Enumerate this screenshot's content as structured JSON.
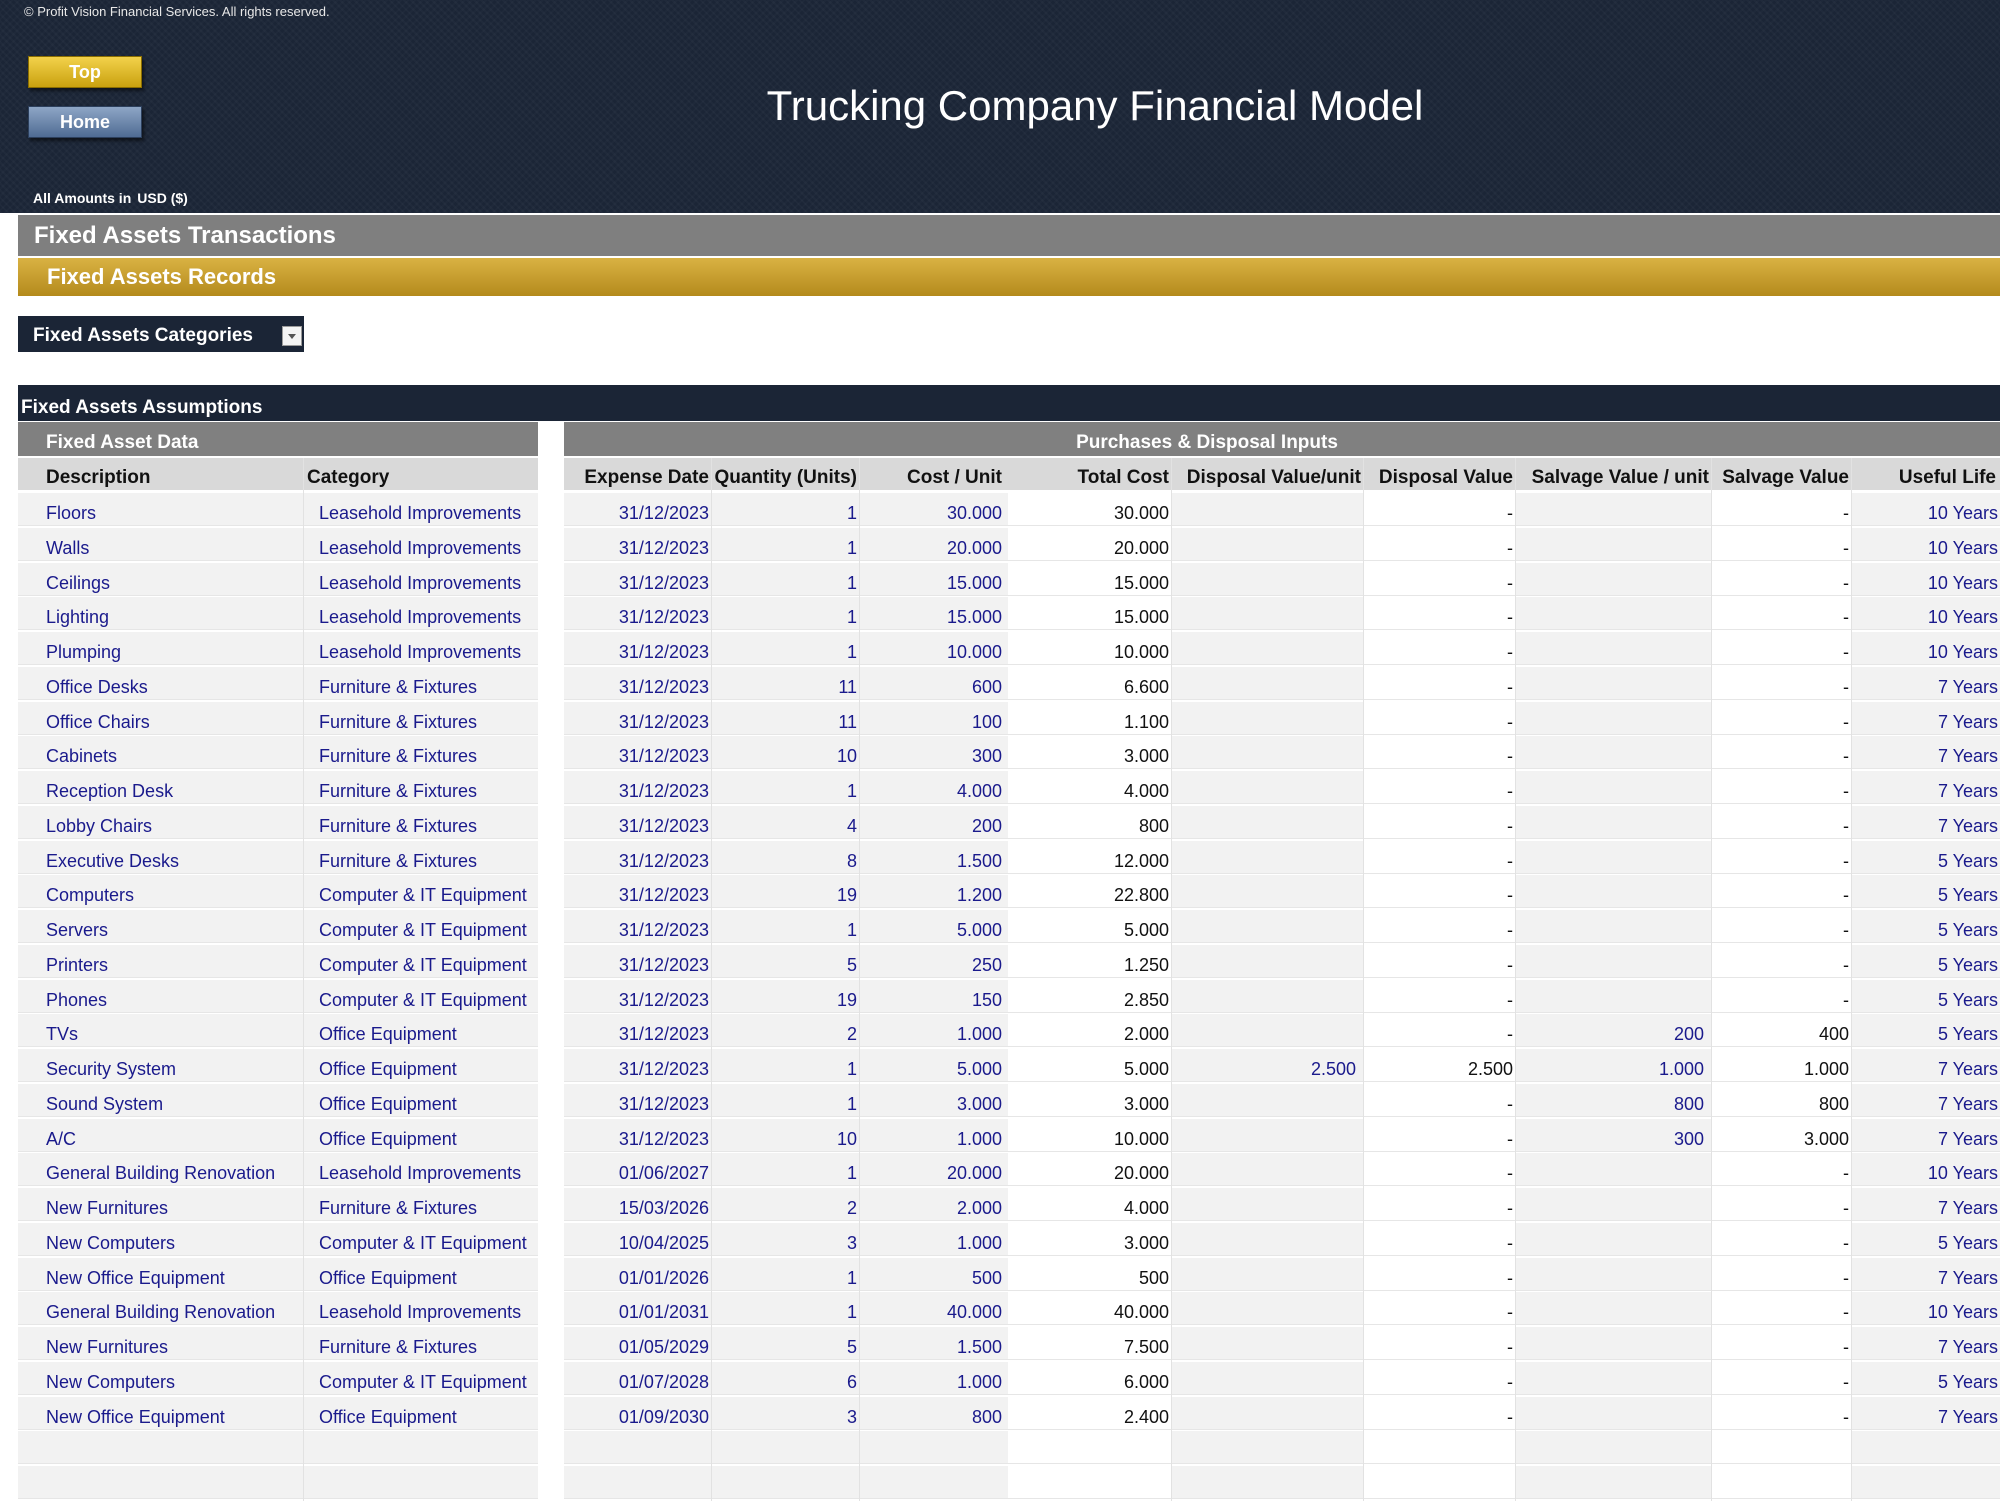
{
  "header": {
    "copyright": "© Profit Vision Financial Services. All rights reserved.",
    "buttons": {
      "top": "Top",
      "home": "Home"
    },
    "title": "Trucking Company Financial Model",
    "currency_label": "All Amounts in",
    "currency_value": "USD ($)"
  },
  "sections": {
    "transactions": "Fixed Assets Transactions",
    "records": "Fixed Assets Records",
    "categories_dropdown": "Fixed Assets Categories",
    "assumptions": "Fixed Assets Assumptions",
    "group_left": "Fixed Asset Data",
    "group_right": "Purchases & Disposal Inputs"
  },
  "table": {
    "columns": [
      "Description",
      "Category",
      "Expense Date",
      "Quantity (Units)",
      "Cost / Unit",
      "Total Cost",
      "Disposal Value/unit",
      "Disposal Value",
      "Salvage Value / unit",
      "Salvage Value",
      "Useful Life"
    ],
    "rows": [
      [
        "Floors",
        "Leasehold Improvements",
        "31/12/2023",
        "1",
        "30.000",
        "30.000",
        "",
        "-",
        "",
        "-",
        "10 Years"
      ],
      [
        "Walls",
        "Leasehold Improvements",
        "31/12/2023",
        "1",
        "20.000",
        "20.000",
        "",
        "-",
        "",
        "-",
        "10 Years"
      ],
      [
        "Ceilings",
        "Leasehold Improvements",
        "31/12/2023",
        "1",
        "15.000",
        "15.000",
        "",
        "-",
        "",
        "-",
        "10 Years"
      ],
      [
        "Lighting",
        "Leasehold Improvements",
        "31/12/2023",
        "1",
        "15.000",
        "15.000",
        "",
        "-",
        "",
        "-",
        "10 Years"
      ],
      [
        "Plumping",
        "Leasehold Improvements",
        "31/12/2023",
        "1",
        "10.000",
        "10.000",
        "",
        "-",
        "",
        "-",
        "10 Years"
      ],
      [
        "Office Desks",
        "Furniture & Fixtures",
        "31/12/2023",
        "11",
        "600",
        "6.600",
        "",
        "-",
        "",
        "-",
        "7 Years"
      ],
      [
        "Office Chairs",
        "Furniture & Fixtures",
        "31/12/2023",
        "11",
        "100",
        "1.100",
        "",
        "-",
        "",
        "-",
        "7 Years"
      ],
      [
        "Cabinets",
        "Furniture & Fixtures",
        "31/12/2023",
        "10",
        "300",
        "3.000",
        "",
        "-",
        "",
        "-",
        "7 Years"
      ],
      [
        "Reception Desk",
        "Furniture & Fixtures",
        "31/12/2023",
        "1",
        "4.000",
        "4.000",
        "",
        "-",
        "",
        "-",
        "7 Years"
      ],
      [
        "Lobby Chairs",
        "Furniture & Fixtures",
        "31/12/2023",
        "4",
        "200",
        "800",
        "",
        "-",
        "",
        "-",
        "7 Years"
      ],
      [
        "Executive Desks",
        "Furniture & Fixtures",
        "31/12/2023",
        "8",
        "1.500",
        "12.000",
        "",
        "-",
        "",
        "-",
        "5 Years"
      ],
      [
        "Computers",
        "Computer & IT Equipment",
        "31/12/2023",
        "19",
        "1.200",
        "22.800",
        "",
        "-",
        "",
        "-",
        "5 Years"
      ],
      [
        "Servers",
        "Computer & IT Equipment",
        "31/12/2023",
        "1",
        "5.000",
        "5.000",
        "",
        "-",
        "",
        "-",
        "5 Years"
      ],
      [
        "Printers",
        "Computer & IT Equipment",
        "31/12/2023",
        "5",
        "250",
        "1.250",
        "",
        "-",
        "",
        "-",
        "5 Years"
      ],
      [
        "Phones",
        "Computer & IT Equipment",
        "31/12/2023",
        "19",
        "150",
        "2.850",
        "",
        "-",
        "",
        "-",
        "5 Years"
      ],
      [
        "TVs",
        "Office Equipment",
        "31/12/2023",
        "2",
        "1.000",
        "2.000",
        "",
        "-",
        "200",
        "400",
        "5 Years"
      ],
      [
        "Security System",
        "Office Equipment",
        "31/12/2023",
        "1",
        "5.000",
        "5.000",
        "2.500",
        "2.500",
        "1.000",
        "1.000",
        "7 Years"
      ],
      [
        "Sound System",
        "Office Equipment",
        "31/12/2023",
        "1",
        "3.000",
        "3.000",
        "",
        "-",
        "800",
        "800",
        "7 Years"
      ],
      [
        "A/C",
        "Office Equipment",
        "31/12/2023",
        "10",
        "1.000",
        "10.000",
        "",
        "-",
        "300",
        "3.000",
        "7 Years"
      ],
      [
        "General Building Renovation",
        "Leasehold Improvements",
        "01/06/2027",
        "1",
        "20.000",
        "20.000",
        "",
        "-",
        "",
        "-",
        "10 Years"
      ],
      [
        "New Furnitures",
        "Furniture & Fixtures",
        "15/03/2026",
        "2",
        "2.000",
        "4.000",
        "",
        "-",
        "",
        "-",
        "7 Years"
      ],
      [
        "New Computers",
        "Computer & IT Equipment",
        "10/04/2025",
        "3",
        "1.000",
        "3.000",
        "",
        "-",
        "",
        "-",
        "5 Years"
      ],
      [
        "New Office Equipment",
        "Office Equipment",
        "01/01/2026",
        "1",
        "500",
        "500",
        "",
        "-",
        "",
        "-",
        "7 Years"
      ],
      [
        "General Building Renovation",
        "Leasehold Improvements",
        "01/01/2031",
        "1",
        "40.000",
        "40.000",
        "",
        "-",
        "",
        "-",
        "10 Years"
      ],
      [
        "New Furnitures",
        "Furniture & Fixtures",
        "01/05/2029",
        "5",
        "1.500",
        "7.500",
        "",
        "-",
        "",
        "-",
        "7 Years"
      ],
      [
        "New Computers",
        "Computer & IT Equipment",
        "01/07/2028",
        "6",
        "1.000",
        "6.000",
        "",
        "-",
        "",
        "-",
        "5 Years"
      ],
      [
        "New Office Equipment",
        "Office Equipment",
        "01/09/2030",
        "3",
        "800",
        "2.400",
        "",
        "-",
        "",
        "-",
        "7 Years"
      ],
      [
        "",
        "",
        "",
        "",
        "",
        "",
        "",
        "",
        "",
        "",
        ""
      ],
      [
        "",
        "",
        "",
        "",
        "",
        "",
        "",
        "",
        "",
        "",
        ""
      ]
    ]
  }
}
